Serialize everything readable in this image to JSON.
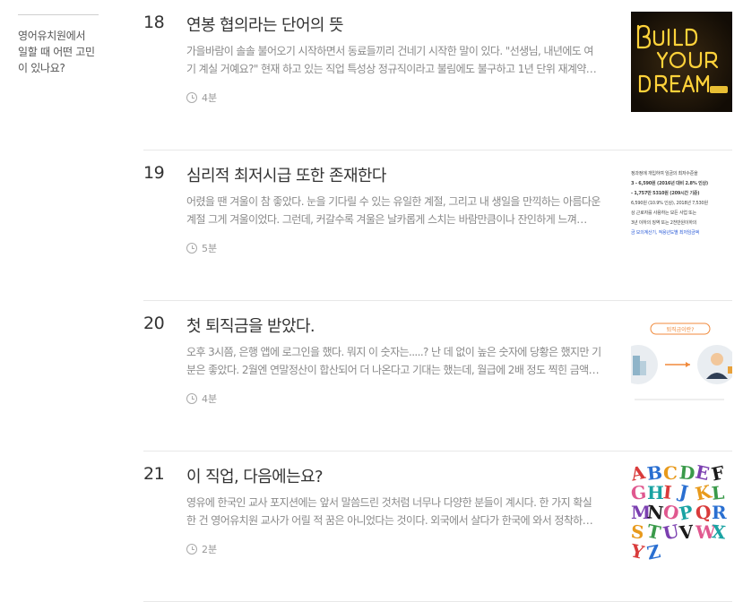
{
  "sidebar": {
    "title_lines": [
      "영어유치원에서",
      "일할 때 어떤 고민",
      "이 있나요?"
    ]
  },
  "articles": [
    {
      "number": "18",
      "title": "연봉 협의라는 단어의 뜻",
      "excerpt_lines": [
        "가을바람이 솔솔 불어오기 시작하면서 동료들끼리 건네기 시작한 말이 있다. \"선생님, 내년에도 여",
        "기 계실 거예요?\" 현재 하고 있는 직업 특성상 정규직이라고 불림에도 불구하고 1년 단위 재계약…"
      ],
      "read_time": "4분",
      "thumb_alt": "BUILD YOUR DREAM"
    },
    {
      "number": "19",
      "title": "심리적 최저시급 또한 존재한다",
      "excerpt_lines": [
        "어렸을 땐 겨울이 참 좋았다. 눈을 기다릴 수 있는 유일한 계절, 그리고 내 생일을 만끽하는 아름다운",
        "계절 그게 겨울이었다. 그런데, 커갈수록 겨울은 날카롭게 스치는 바람만큼이나 잔인하게 느껴…"
      ],
      "read_time": "5분",
      "thumb_lines": [
        "정과정에 개입하여 임금의 최저수준을",
        "3 - 6,590원 (2016년 대비 2.8% 인상)",
        "- 1,757만 5310원 (209시간 기준)",
        "6,590원 (10.9% 인상), 2018년 7,530원",
        "상 근로자를 사용하는 모든 사업 또는",
        "3년 이하의 징역 또는 2천만원이하의",
        "금 모의계산기, 적용년도별 최저임금액"
      ]
    },
    {
      "number": "20",
      "title": "첫 퇴직금을 받았다.",
      "excerpt_lines": [
        "오후 3시쯤, 은행 앱에 로그인을 했다. 뭐지 이 숫자는.....? 난 데 없이 높은 숫자에 당황은 했지만 기",
        "분은 좋았다. 2월엔 연말정산이 합산되어 더 나온다고 기대는 했는데, 월급에 2배 정도 찍힌 금액…"
      ],
      "read_time": "4분",
      "thumb_label": "퇴직금이란?"
    },
    {
      "number": "21",
      "title": "이 직업, 다음에는요?",
      "excerpt_lines": [
        "영유에 한국인 교사 포지션에는 앞서 말씀드린 것처럼 너무나 다양한 분들이 계시다. 한 가지 확실",
        "한 건 영어유치원 교사가 어릴 적 꿈은 아니었다는 것이다. 외국에서 살다가 한국에 와서 정착하…"
      ],
      "read_time": "2분",
      "thumb_letters": "ABCDEFGHIJKLMNOPQRSTUVWXYZ"
    }
  ]
}
